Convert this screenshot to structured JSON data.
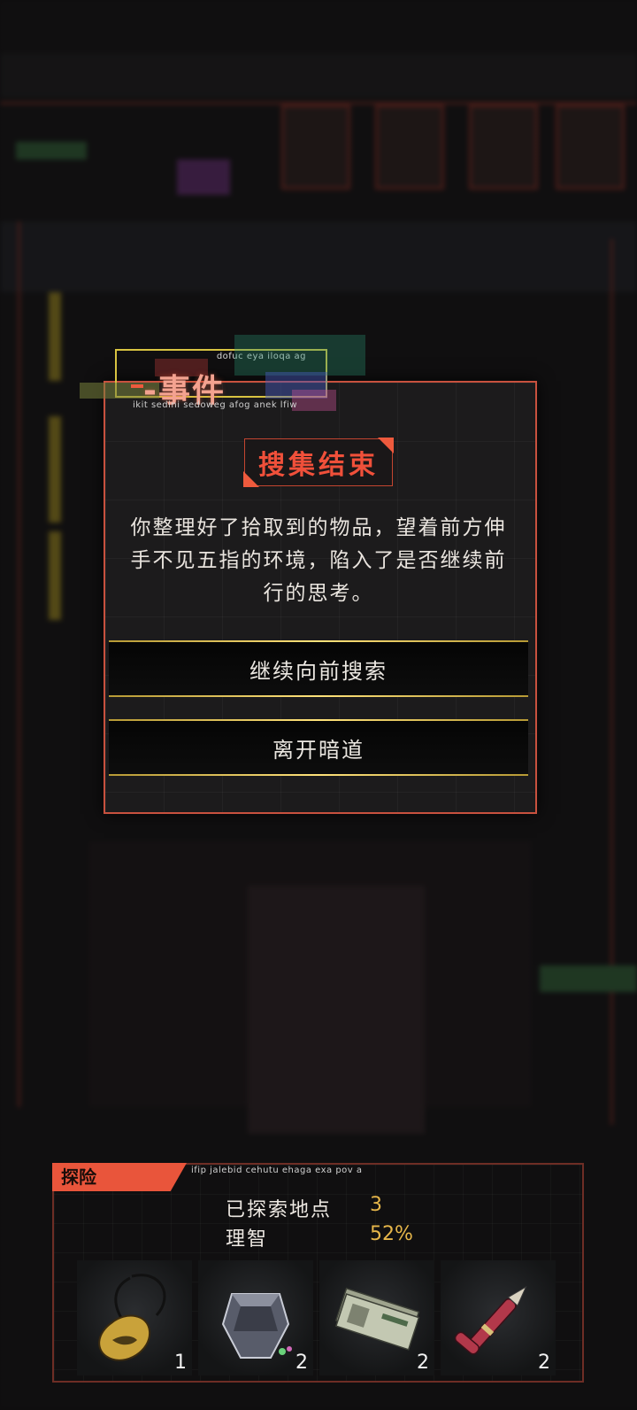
{
  "event": {
    "header_title": "-事件",
    "header_caption_top": "dofuc eya iloqa ag",
    "header_caption_bottom": "ikit sedini sedoweg afog anek lfiw",
    "result_title": "搜集结束",
    "story_text": "你整理好了拾取到的物品，望着前方伸手不见五指的环境，陷入了是否继续前行的思考。",
    "options": [
      {
        "label": "继续向前搜索"
      },
      {
        "label": "离开暗道"
      }
    ]
  },
  "expedition": {
    "tab_label": "探险",
    "caption": "ifip jalebid cehutu ehaga exa pov a",
    "stats": [
      {
        "label": "已探索地点",
        "value": "3"
      },
      {
        "label": "理智",
        "value": "52%"
      }
    ],
    "items": [
      {
        "icon": "fish-pendant-icon",
        "count": "1"
      },
      {
        "icon": "crystal-vessel-icon",
        "count": "2"
      },
      {
        "icon": "banknotes-icon",
        "count": "2"
      },
      {
        "icon": "fountain-pen-icon",
        "count": "2"
      }
    ]
  },
  "colors": {
    "accent": "#ee5a3d",
    "gold": "#d8c341",
    "stat_value": "#e6b64a"
  }
}
